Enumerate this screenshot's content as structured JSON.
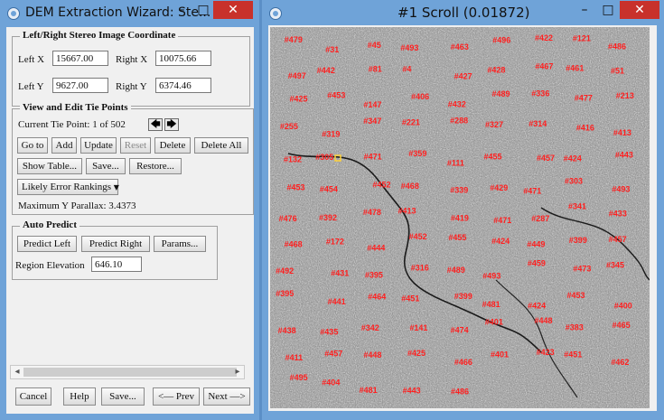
{
  "left_window": {
    "title": "DEM Extraction Wizard: Ste...",
    "minimize": "–",
    "maximize": "□",
    "close": "✕",
    "coords": {
      "legend": "Left/Right Stereo Image Coordinate",
      "left_x_label": "Left X",
      "left_x_value": "15667.00",
      "right_x_label": "Right X",
      "right_x_value": "10075.66",
      "left_y_label": "Left Y",
      "left_y_value": "9627.00",
      "right_y_label": "Right Y",
      "right_y_value": "6374.46"
    },
    "tie_points": {
      "legend": "View and Edit Tie Points",
      "current_label": "Current Tie Point: 1 of 502",
      "prev_arrow": "🡄",
      "next_arrow": "🡆",
      "goto": "Go to",
      "add": "Add",
      "update": "Update",
      "reset": "Reset",
      "delete": "Delete",
      "delete_all": "Delete All",
      "show_table": "Show Table...",
      "save": "Save...",
      "restore": "Restore...",
      "error_rankings": "Likely Error Rankings",
      "max_parallax": "Maximum Y Parallax: 3.4373"
    },
    "auto_predict": {
      "legend": "Auto Predict",
      "predict_left": "Predict Left",
      "predict_right": "Predict Right",
      "params": "Params...",
      "region_elev_label": "Region Elevation",
      "region_elev_value": "646.10"
    },
    "footer": {
      "cancel": "Cancel",
      "help": "Help",
      "save": "Save...",
      "prev": "<— Prev",
      "next": "Next —>"
    }
  },
  "right_window": {
    "title": "#1 Scroll (0.01872)",
    "minimize": "–",
    "maximize": "□",
    "close": "✕"
  },
  "tie_point_labels": [
    "#479",
    "#31",
    "#45",
    "#493",
    "#463",
    "#496",
    "#422",
    "#121",
    "#486",
    "#497",
    "#442",
    "#81",
    "#4",
    "#427",
    "#428",
    "#467",
    "#461",
    "#51",
    "#425",
    "#453",
    "#147",
    "#406",
    "#432",
    "#489",
    "#336",
    "#477",
    "#213",
    "#255",
    "#319",
    "#347",
    "#221",
    "#288",
    "#327",
    "#314",
    "#416",
    "#413",
    "#132",
    "#305",
    "#471",
    "#359",
    "#111",
    "#455",
    "#457",
    "#424",
    "#443",
    "#453",
    "#454",
    "#452",
    "#468",
    "#339",
    "#429",
    "#471",
    "#303",
    "#493",
    "#476",
    "#392",
    "#478",
    "#413",
    "#419",
    "#471",
    "#287",
    "#341",
    "#433",
    "#468",
    "#172",
    "#444",
    "#452",
    "#455",
    "#424",
    "#449",
    "#399",
    "#457",
    "#492",
    "#431",
    "#395",
    "#316",
    "#489",
    "#493",
    "#459",
    "#473",
    "#345",
    "#395",
    "#441",
    "#464",
    "#451",
    "#399",
    "#481",
    "#424",
    "#453",
    "#400",
    "#438",
    "#435",
    "#342",
    "#141",
    "#474",
    "#401",
    "#448",
    "#383",
    "#465",
    "#411",
    "#457",
    "#448",
    "#425",
    "#466",
    "#401",
    "#423",
    "#451",
    "#462",
    "#495",
    "#404",
    "#481",
    "#443",
    "#486"
  ],
  "colors": {
    "title_bar": "#6fa3d8",
    "close_button": "#c8312b",
    "marker": "#ff1f1f",
    "selected_marker": "#ffd23a"
  }
}
